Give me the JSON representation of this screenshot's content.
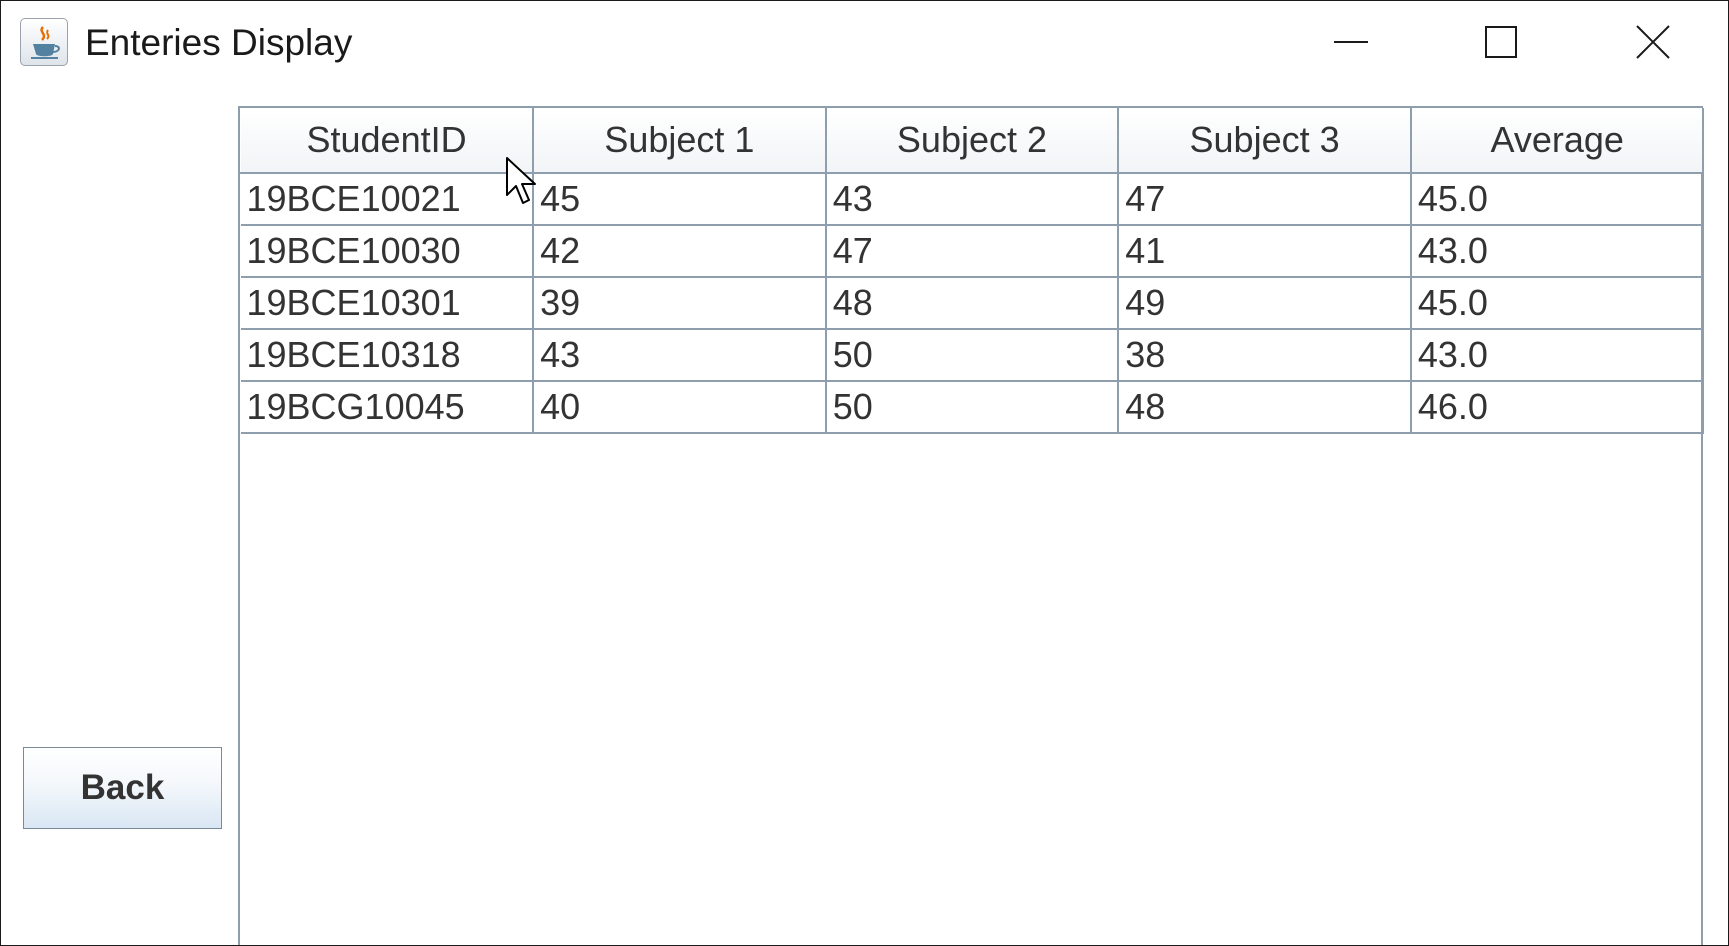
{
  "window": {
    "title": "Enteries Display",
    "icon": "java-cup-icon",
    "controls": [
      "minimize-icon",
      "maximize-icon",
      "close-icon"
    ]
  },
  "left_panel": {
    "back_label": "Back"
  },
  "table": {
    "columns": [
      "StudentID",
      "Subject 1",
      "Subject 2",
      "Subject 3",
      "Average"
    ],
    "rows": [
      [
        "19BCE10021",
        "45",
        "43",
        "47",
        "45.0"
      ],
      [
        "19BCE10030",
        "42",
        "47",
        "41",
        "43.0"
      ],
      [
        "19BCE10301",
        "39",
        "48",
        "49",
        "45.0"
      ],
      [
        "19BCE10318",
        "43",
        "50",
        "38",
        "43.0"
      ],
      [
        "19BCG10045",
        "40",
        "50",
        "48",
        "46.0"
      ]
    ]
  },
  "colors": {
    "grid_line": "#8f9eac",
    "button_gradient_bottom": "#d9e6f3",
    "text": "#333333",
    "java_icon_orange": "#e76f00",
    "java_icon_blue": "#5382a1"
  }
}
